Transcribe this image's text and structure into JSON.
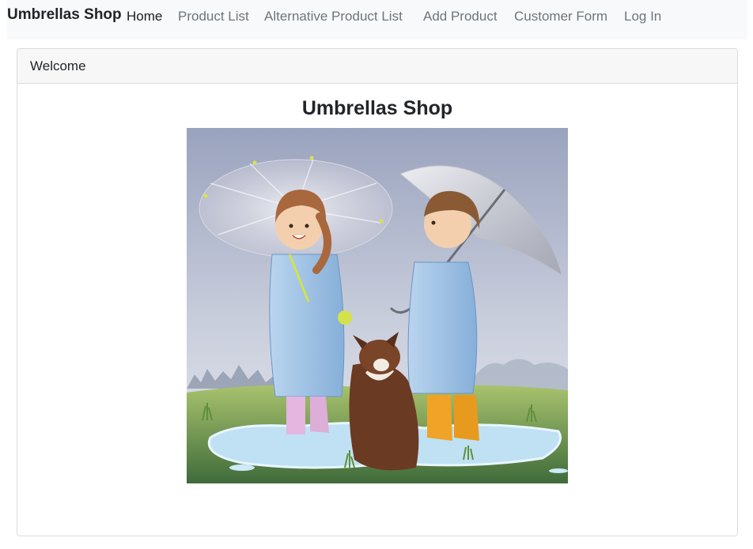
{
  "navbar": {
    "brand": "Umbrellas Shop",
    "links": [
      {
        "label": "Home",
        "active": true
      },
      {
        "label": "Product List",
        "active": false
      },
      {
        "label": "Alternative Product List",
        "active": false
      },
      {
        "label": "Add Product",
        "active": false
      },
      {
        "label": "Customer Form",
        "active": false
      },
      {
        "label": "Log In",
        "active": false
      }
    ]
  },
  "card": {
    "header": "Welcome",
    "title": "Umbrellas Shop"
  },
  "colors": {
    "navbar_bg": "#f8f9fa",
    "link_muted": "#6c757d",
    "link_active": "#1b1e21",
    "card_header_bg": "#f7f7f7",
    "border": "#d9dcdf"
  }
}
